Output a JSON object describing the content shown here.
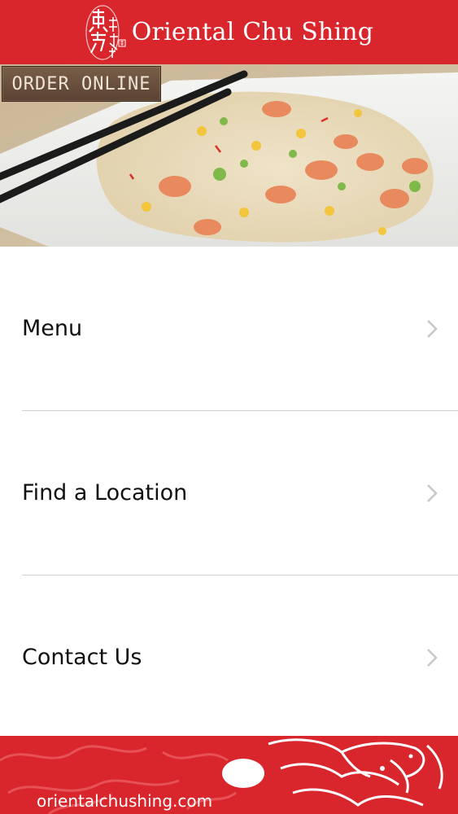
{
  "header": {
    "brand_name": "Oriental Chu Shing",
    "logo_icon": "chinese-calligraphy-seal-icon"
  },
  "hero": {
    "order_button_label": "ORDER ONLINE"
  },
  "menu": {
    "items": [
      {
        "label": "Menu",
        "icon": "chevron-right-icon"
      },
      {
        "label": "Find a Location",
        "icon": "chevron-right-icon"
      },
      {
        "label": "Contact Us",
        "icon": "chevron-right-icon"
      }
    ]
  },
  "footer": {
    "website": "orientalchushing.com",
    "decoration_icon": "dragon-pearl-icon"
  },
  "colors": {
    "brand_red": "#d8262c",
    "divider": "#cfcfcf",
    "chevron": "#c7c7cc"
  }
}
